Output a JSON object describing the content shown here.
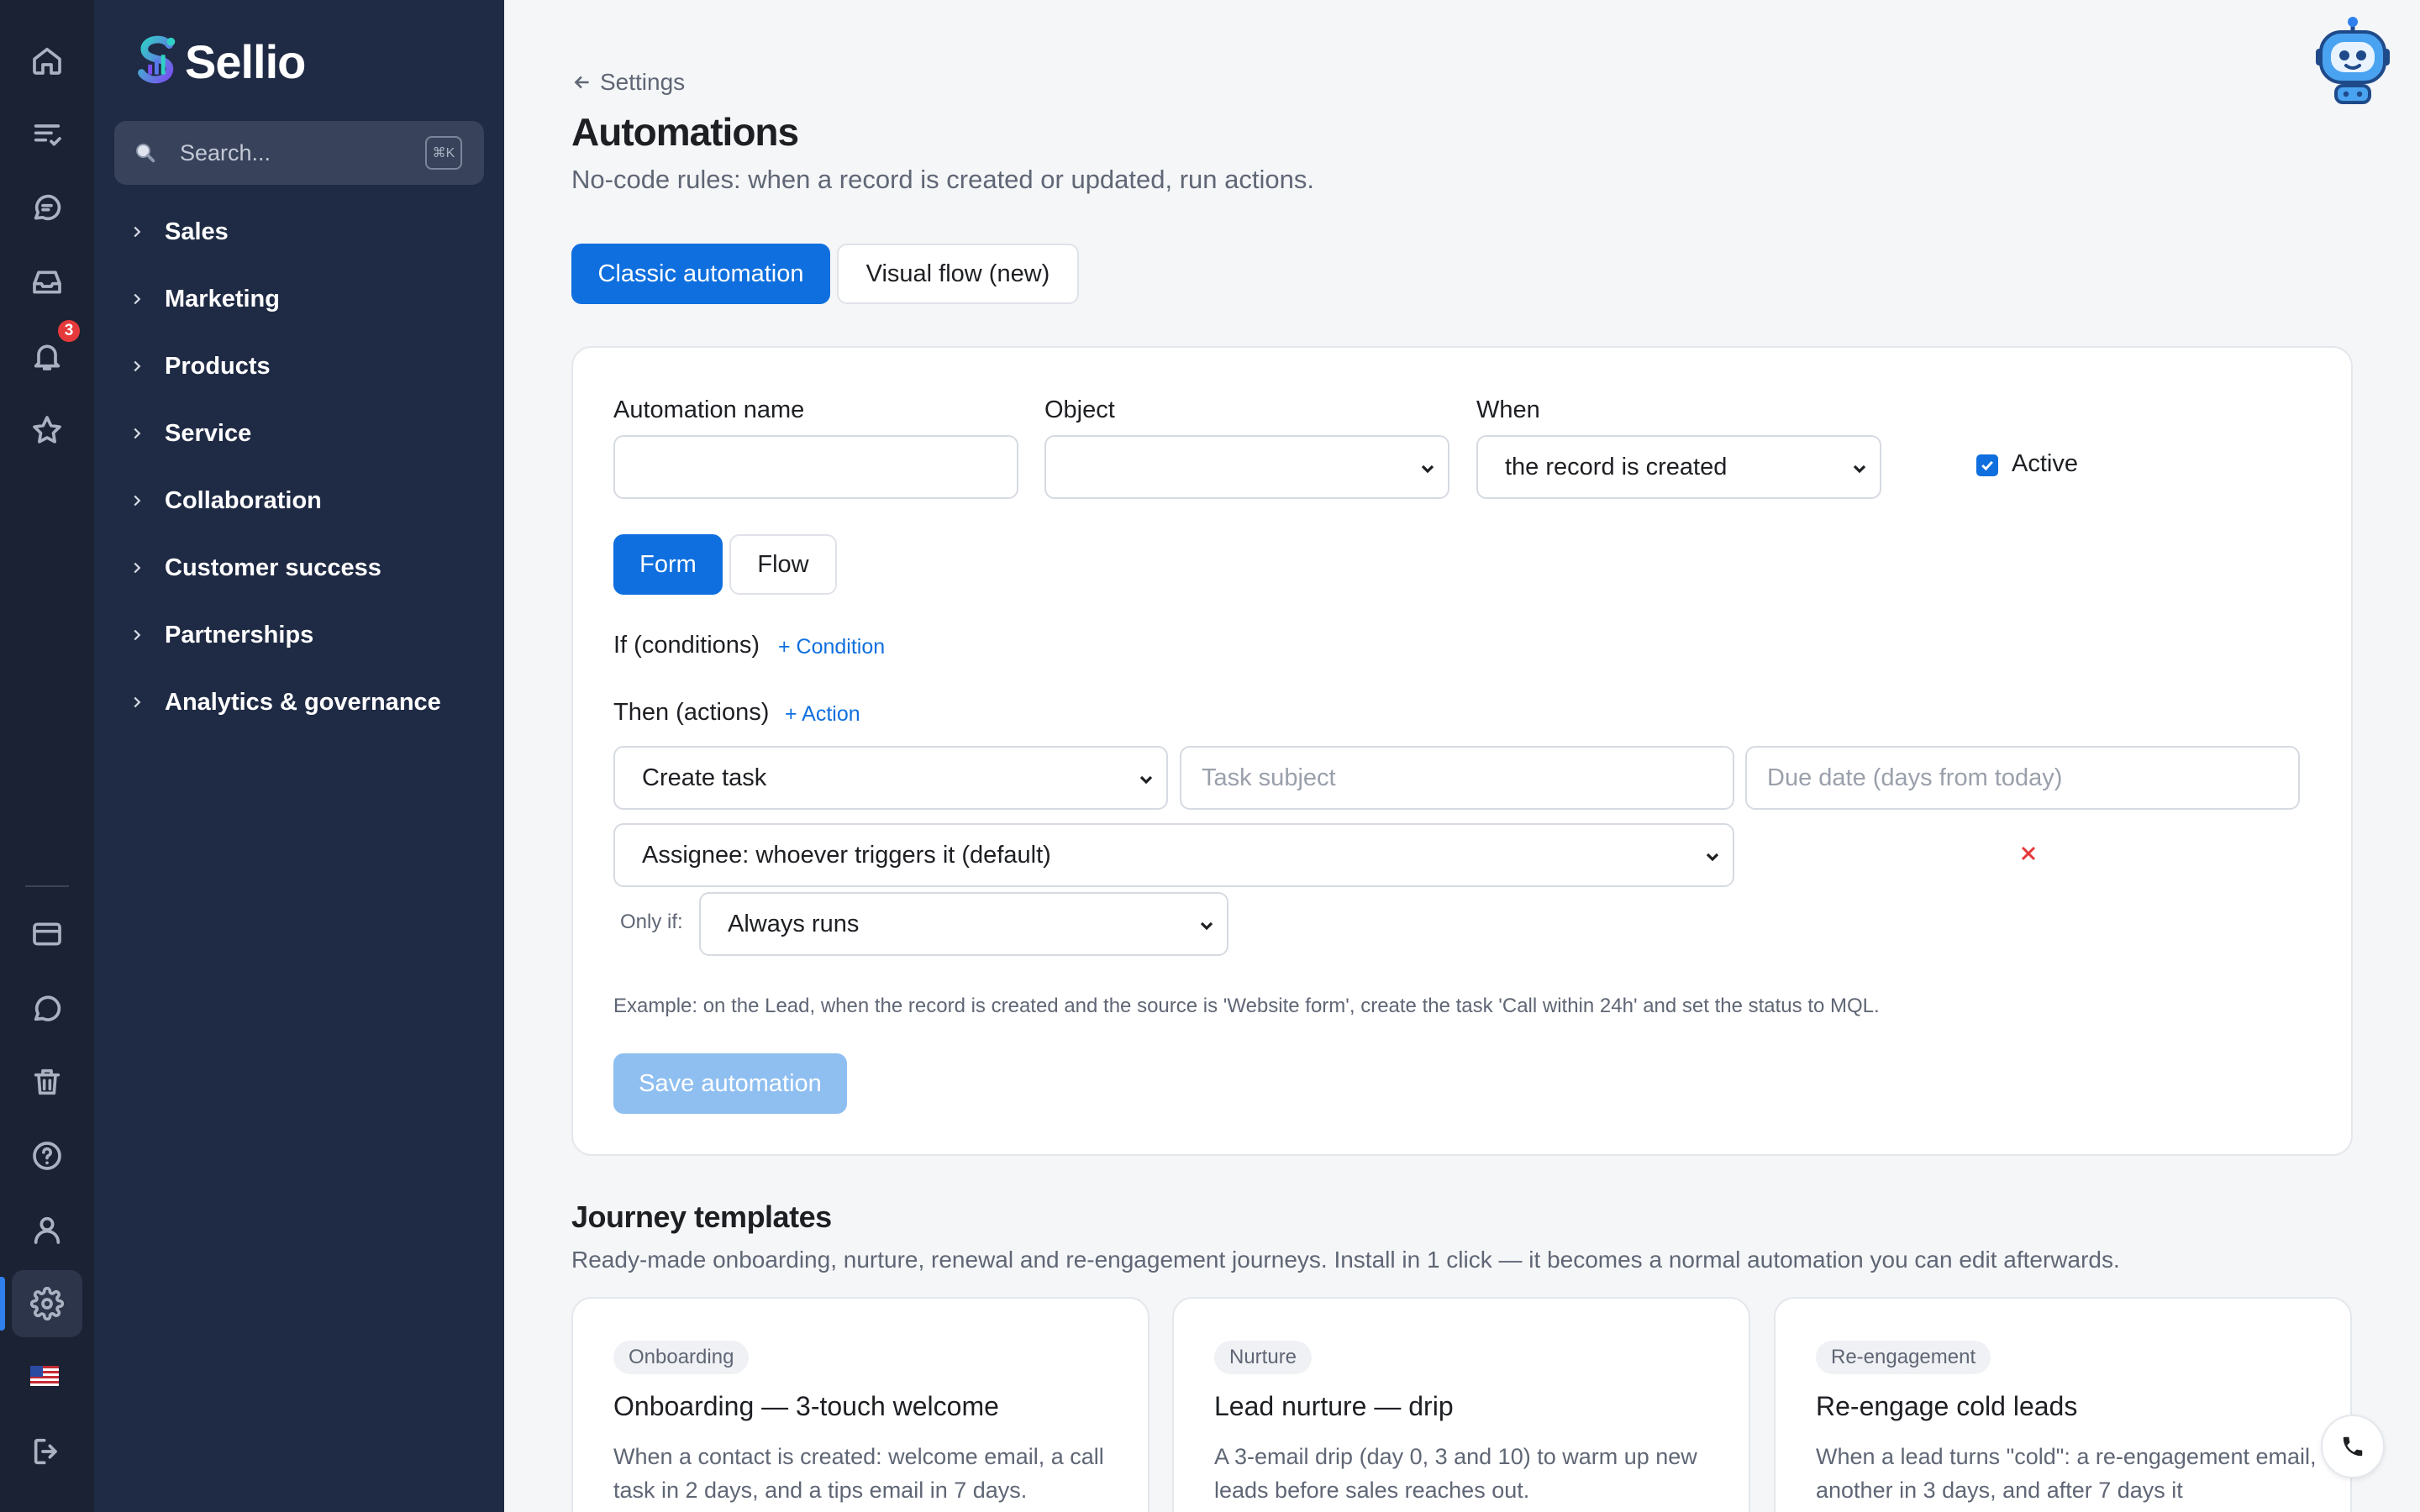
{
  "rail": {
    "notification_count": "3"
  },
  "sidebar": {
    "brand": "Sellio",
    "search_placeholder": "Search...",
    "search_shortcut": "⌘K",
    "items": [
      {
        "label": "Sales"
      },
      {
        "label": "Marketing"
      },
      {
        "label": "Products"
      },
      {
        "label": "Service"
      },
      {
        "label": "Collaboration"
      },
      {
        "label": "Customer success"
      },
      {
        "label": "Partnerships"
      },
      {
        "label": "Analytics & governance"
      }
    ]
  },
  "header": {
    "breadcrumb": "Settings",
    "title": "Automations",
    "subtitle": "No-code rules: when a record is created or updated, run actions."
  },
  "mode_tabs": {
    "classic": "Classic automation",
    "visual": "Visual flow (new)"
  },
  "form": {
    "name_label": "Automation name",
    "name_value": "",
    "object_label": "Object",
    "object_value": "",
    "when_label": "When",
    "when_value": "the record is created",
    "active_label": "Active",
    "active_checked": true,
    "view_form": "Form",
    "view_flow": "Flow",
    "if_label": "If (conditions)",
    "add_condition": "+ Condition",
    "then_label": "Then (actions)",
    "add_action": "+ Action",
    "action_type": "Create task",
    "task_subject_placeholder": "Task subject",
    "due_date_placeholder": "Due date (days from today)",
    "assignee": "Assignee: whoever triggers it (default)",
    "only_if_label": "Only if:",
    "only_if_value": "Always runs",
    "example": "Example: on the Lead, when the record is created and the source is 'Website form', create the task 'Call within 24h' and set the status to MQL.",
    "save_label": "Save automation"
  },
  "templates": {
    "title": "Journey templates",
    "description": "Ready-made onboarding, nurture, renewal and re-engagement journeys. Install in 1 click — it becomes a normal automation you can edit afterwards.",
    "items": [
      {
        "tag": "Onboarding",
        "title": "Onboarding — 3-touch welcome",
        "description": "When a contact is created: welcome email, a call task in 2 days, and a tips email in 7 days."
      },
      {
        "tag": "Nurture",
        "title": "Lead nurture — drip",
        "description": "A 3-email drip (day 0, 3 and 10) to warm up new leads before sales reaches out."
      },
      {
        "tag": "Re-engagement",
        "title": "Re-engage cold leads",
        "description": "When a lead turns \"cold\": a re-engagement email, another in 3 days, and after 7 days it"
      }
    ]
  },
  "colors": {
    "primary": "#0f6fde",
    "sidebar": "#1f2a44",
    "rail": "#1b2233",
    "danger": "#e5393b"
  }
}
